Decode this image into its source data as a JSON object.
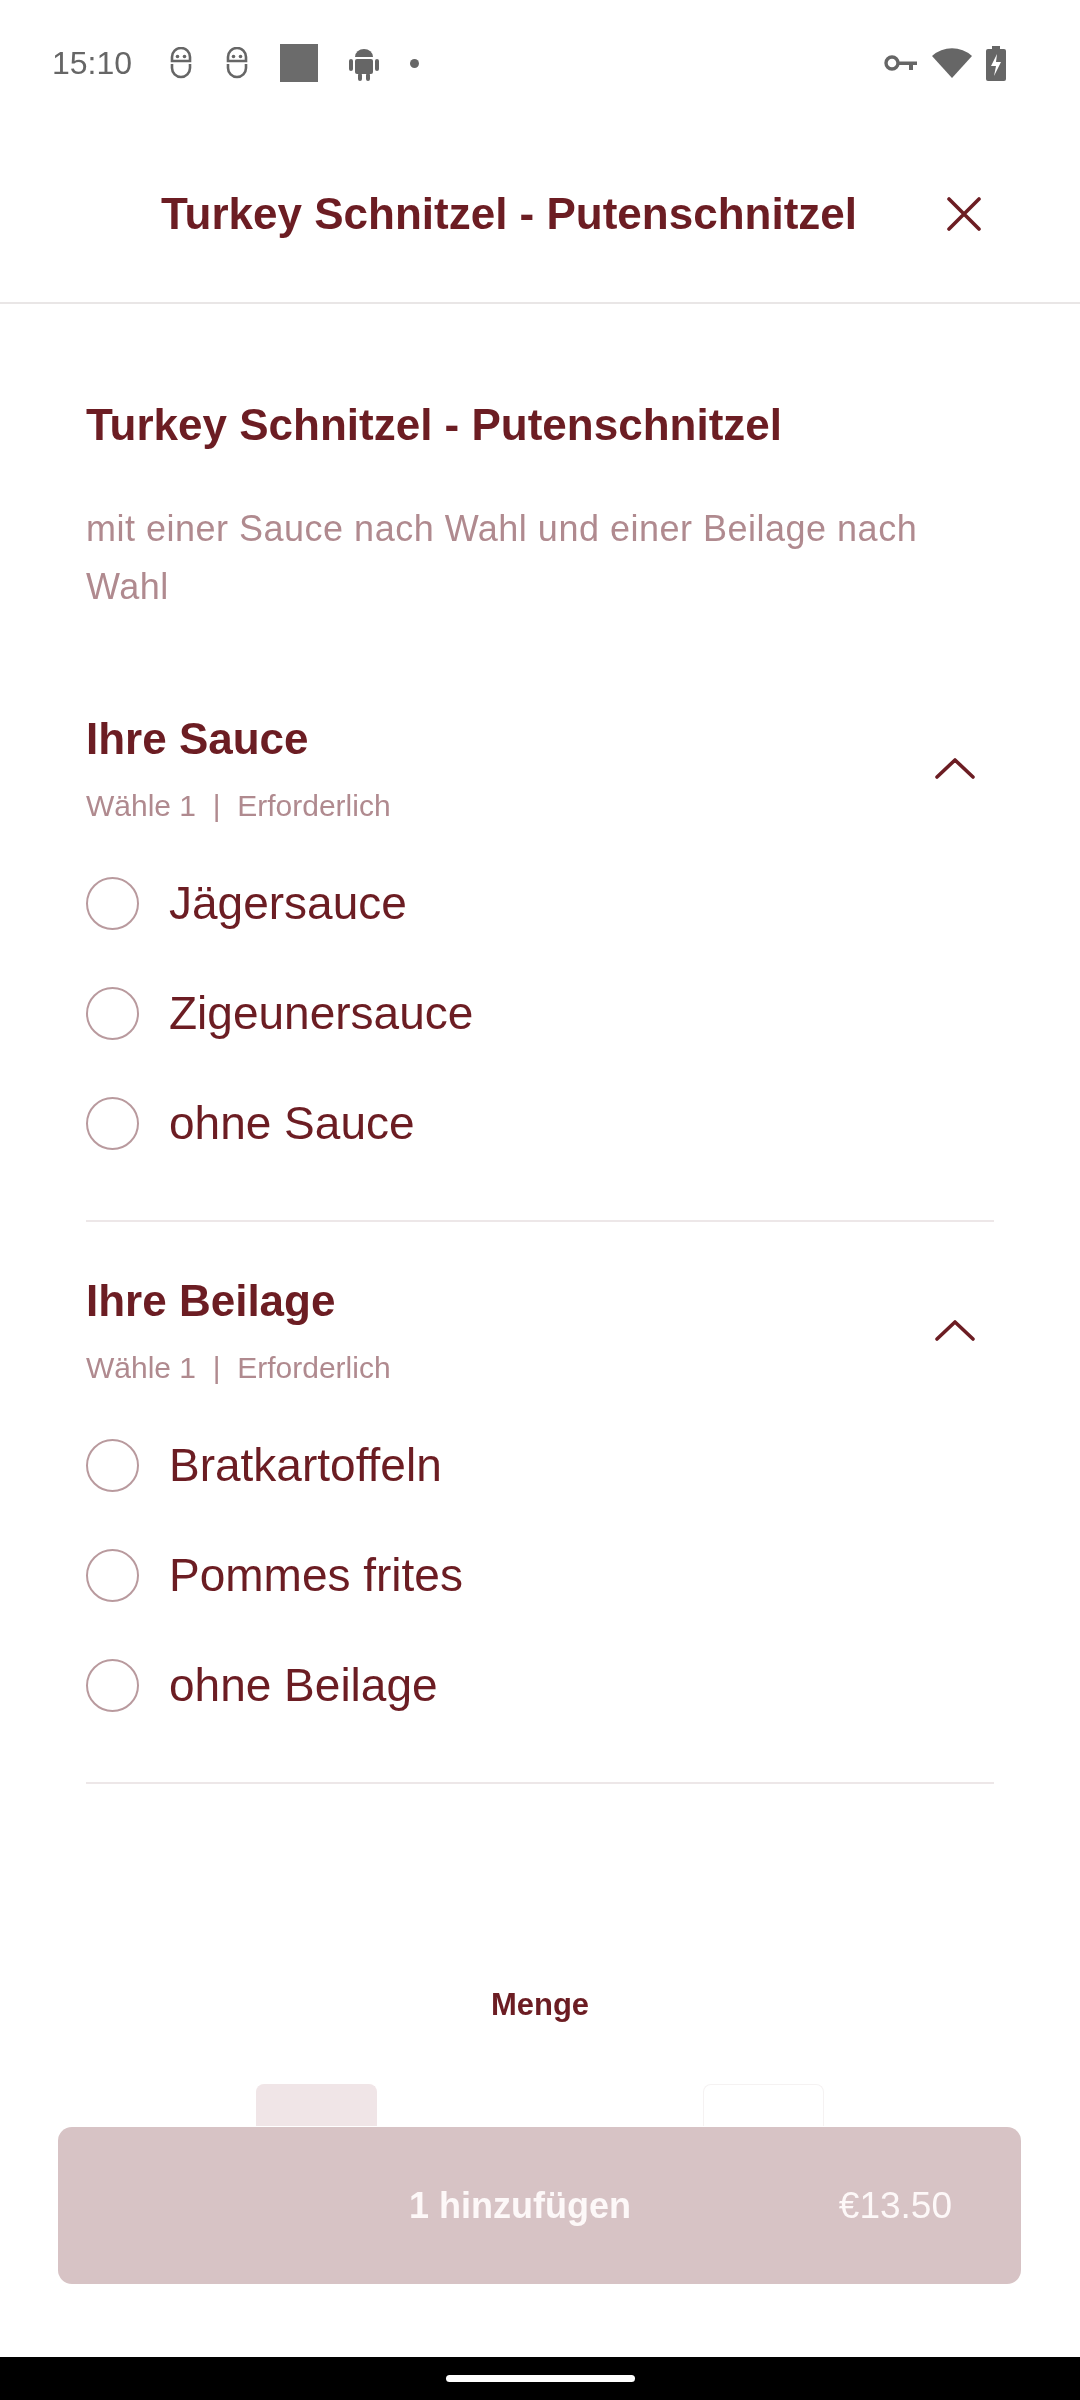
{
  "status_bar": {
    "time": "15:10"
  },
  "header": {
    "title": "Turkey Schnitzel - Putenschnitzel"
  },
  "product": {
    "title": "Turkey Schnitzel - Putenschnitzel",
    "description": "mit einer Sauce nach Wahl und einer Beilage nach Wahl"
  },
  "option_groups": [
    {
      "title": "Ihre Sauce",
      "rule": "Wähle 1  |  Erforderlich",
      "expanded": true,
      "options": [
        {
          "label": "Jägersauce",
          "selected": false
        },
        {
          "label": "Zigeunersauce",
          "selected": false
        },
        {
          "label": "ohne Sauce",
          "selected": false
        }
      ]
    },
    {
      "title": "Ihre Beilage",
      "rule": "Wähle 1  |  Erforderlich",
      "expanded": true,
      "options": [
        {
          "label": "Bratkartoffeln",
          "selected": false
        },
        {
          "label": "Pommes frites",
          "selected": false
        },
        {
          "label": "ohne Beilage",
          "selected": false
        }
      ]
    }
  ],
  "quantity": {
    "label": "Menge"
  },
  "add_button": {
    "label": "1 hinzufügen",
    "price": "€13.50",
    "disabled": true
  }
}
